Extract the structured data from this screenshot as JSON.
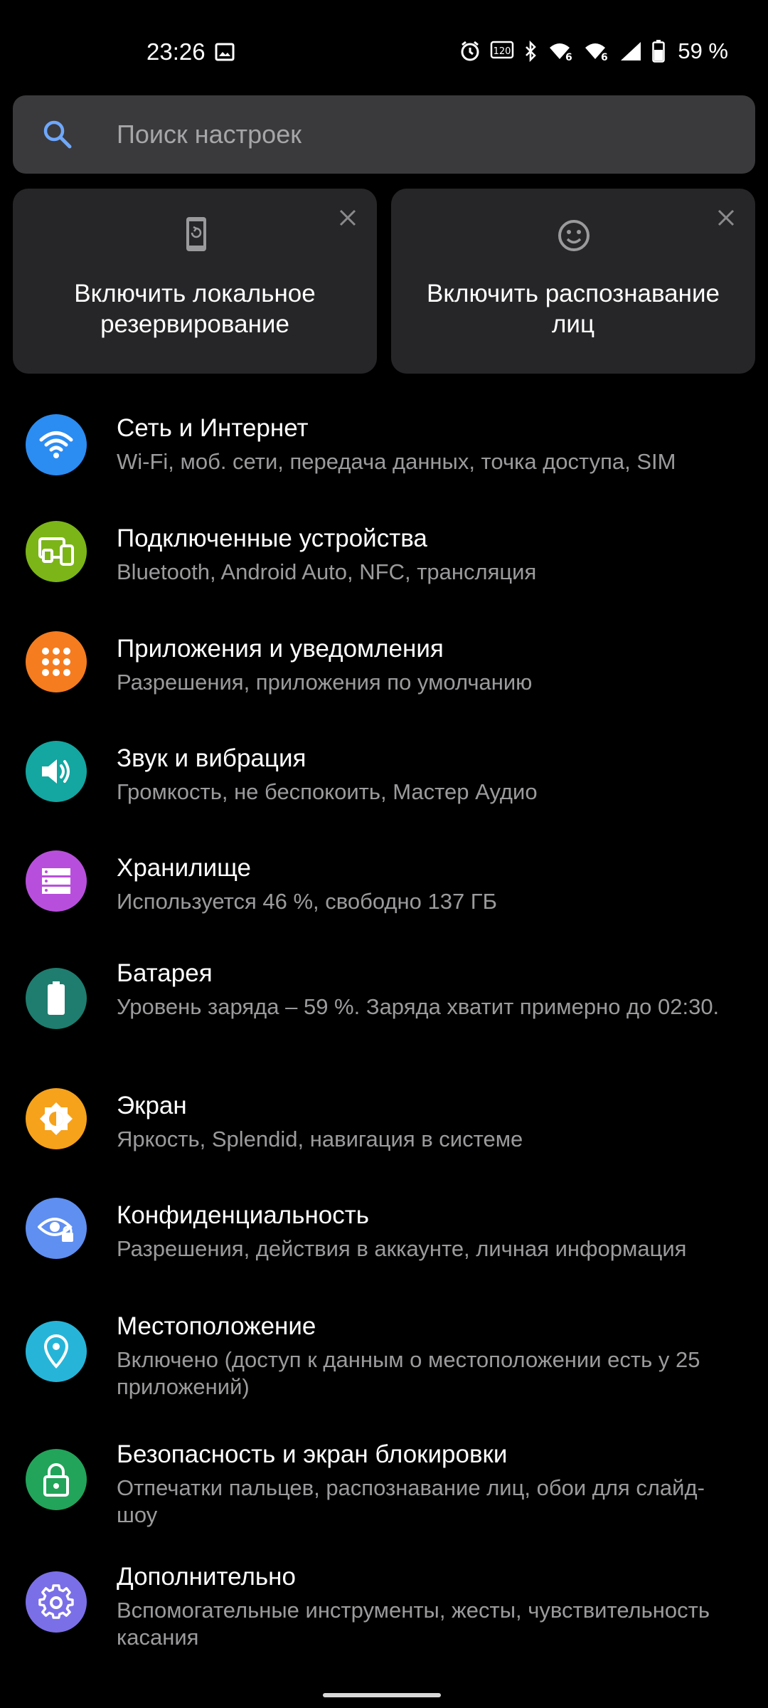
{
  "status_bar": {
    "time": "23:26",
    "battery_text": "59 %",
    "icons": [
      "image-icon",
      "alarm-icon",
      "refresh-rate-icon",
      "bluetooth-icon",
      "wifi6-icon",
      "wifi6-icon",
      "cell-signal-icon",
      "battery-icon"
    ]
  },
  "search": {
    "placeholder": "Поиск настроек"
  },
  "suggestions": [
    {
      "text": "Включить локальное резервирование",
      "icon": "phone-backup-icon"
    },
    {
      "text": "Включить распознавание лиц",
      "icon": "face-icon"
    }
  ],
  "settings": [
    {
      "title": "Сеть и Интернет",
      "subtitle": "Wi‑Fi, моб. сети, передача данных, точка доступа, SIM",
      "icon": "wifi-icon",
      "color": "#2b8cf2"
    },
    {
      "title": "Подключенные устройства",
      "subtitle": "Bluetooth, Android Auto, NFC, трансляция",
      "icon": "devices-icon",
      "color": "#7cb518"
    },
    {
      "title": "Приложения и уведомления",
      "subtitle": "Разрешения, приложения по умолчанию",
      "icon": "apps-grid-icon",
      "color": "#f57c1f"
    },
    {
      "title": "Звук и вибрация",
      "subtitle": "Громкость, не беспокоить, Мастер Аудио",
      "icon": "volume-icon",
      "color": "#14a6a1"
    },
    {
      "title": "Хранилище",
      "subtitle": "Используется 46 %, свободно 137 ГБ",
      "icon": "storage-icon",
      "color": "#b84fdc"
    },
    {
      "title": "Батарея",
      "subtitle": "Уровень заряда – 59 %. Заряда хватит примерно до 02:30.",
      "icon": "battery-icon",
      "color": "#1e7d6e"
    },
    {
      "title": "Экран",
      "subtitle": "Яркость, Splendid, навигация в системе",
      "icon": "brightness-icon",
      "color": "#f6a21a"
    },
    {
      "title": "Конфиденциальность",
      "subtitle": "Разрешения, действия в аккаунте, личная информация",
      "icon": "privacy-eye-icon",
      "color": "#5f8ff0"
    },
    {
      "title": "Местоположение",
      "subtitle": "Включено (доступ к данным о местоположении есть у 25 приложений)",
      "icon": "location-pin-icon",
      "color": "#26b5d8"
    },
    {
      "title": "Безопасность и экран блокировки",
      "subtitle": "Отпечатки пальцев, распознавание лиц, обои для слайд-шоу",
      "icon": "lock-icon",
      "color": "#22a45a"
    },
    {
      "title": "Дополнительно",
      "subtitle": "Вспомогательные инструменты, жесты, чувствительность касания",
      "icon": "gear-icon",
      "color": "#7b6fe8"
    }
  ]
}
